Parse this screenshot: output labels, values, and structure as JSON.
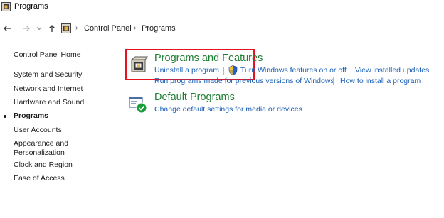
{
  "window": {
    "title": "Programs"
  },
  "address_bar": {
    "breadcrumbs": [
      "Control Panel",
      "Programs"
    ]
  },
  "sidebar": {
    "home": "Control Panel Home",
    "items": [
      "System and Security",
      "Network and Internet",
      "Hardware and Sound",
      "Programs",
      "User Accounts",
      "Appearance and",
      "Personalization",
      "Clock and Region",
      "Ease of Access"
    ],
    "active": "Programs"
  },
  "categories": {
    "programs_features": {
      "title": "Programs and Features",
      "tasks": {
        "uninstall": "Uninstall a program",
        "windows_features": "Turn Windows features on or off",
        "installed_updates": "View installed updates",
        "previous_versions": "Run programs made for previous versions of Windows",
        "how_to_install": "How to install a program"
      }
    },
    "default_programs": {
      "title": "Default Programs",
      "tasks": {
        "change_defaults": "Change default settings for media or devices"
      }
    }
  },
  "colors": {
    "category_title": "#1e7e34",
    "link": "#1a5fb4",
    "highlight_box": "#e81123"
  },
  "icons": {
    "title": "programs-icon",
    "back": "arrow-left-icon",
    "forward": "arrow-right-icon",
    "up": "arrow-up-icon",
    "features": "programs-and-features-icon",
    "shield": "uac-shield-icon",
    "defaults": "default-programs-icon"
  }
}
